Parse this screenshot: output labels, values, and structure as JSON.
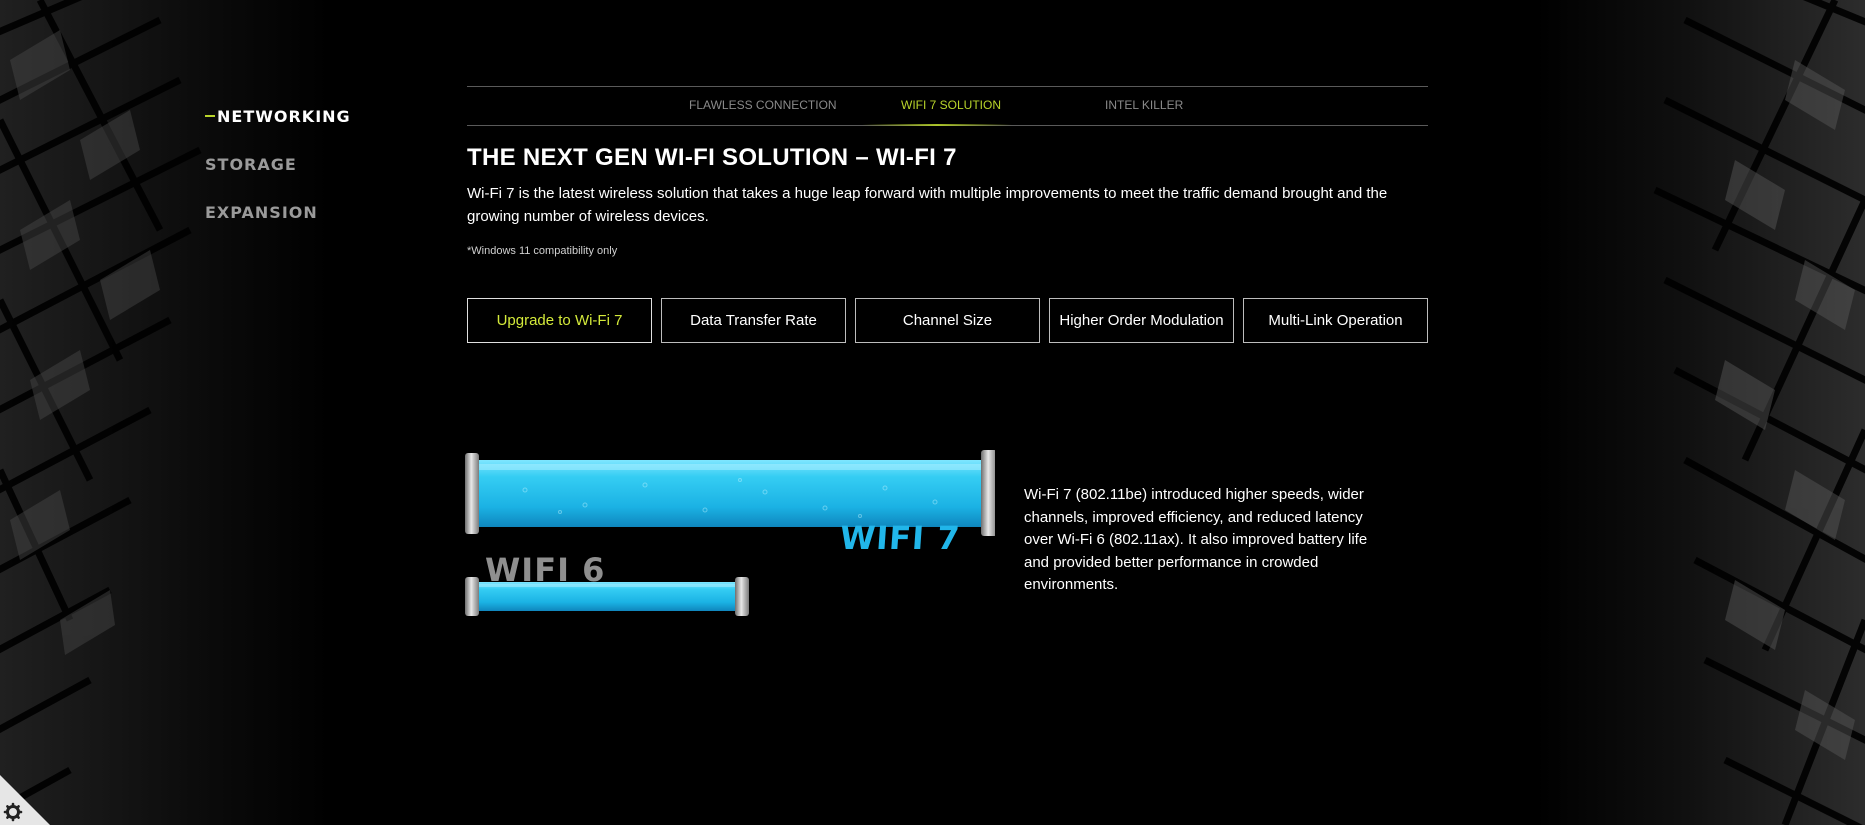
{
  "side_nav": {
    "items": [
      {
        "label": "NETWORKING",
        "active": true
      },
      {
        "label": "STORAGE",
        "active": false
      },
      {
        "label": "EXPANSION",
        "active": false
      }
    ]
  },
  "tabs": [
    {
      "label": "FLAWLESS CONNECTION",
      "active": false
    },
    {
      "label": "WIFI 7 SOLUTION",
      "active": true
    },
    {
      "label": "INTEL KILLER",
      "active": false
    }
  ],
  "section": {
    "title": "THE NEXT GEN WI-FI SOLUTION – WI-FI 7",
    "description": "Wi-Fi 7 is the latest wireless solution that takes a huge leap forward with multiple improvements to meet the traffic demand brought and the growing number of wireless devices.",
    "note": "*Windows 11 compatibility only"
  },
  "features": [
    {
      "label": "Upgrade to Wi-Fi 7",
      "active": true
    },
    {
      "label": "Data Transfer Rate",
      "active": false
    },
    {
      "label": "Channel Size",
      "active": false
    },
    {
      "label": "Higher Order Modulation",
      "active": false
    },
    {
      "label": "Multi-Link Operation",
      "active": false
    }
  ],
  "illustration": {
    "wifi7_label": "WIFI 7",
    "wifi6_label": "WIFI 6",
    "text": "Wi-Fi 7 (802.11be) introduced higher speeds, wider channels, improved efficiency, and reduced latency over Wi-Fi 6 (802.11ax). It also improved battery life and provided better performance in crowded environments."
  },
  "colors": {
    "accent": "#b9d42a",
    "active_feature_text": "#d4ea3a",
    "wifi7_blue": "#21b6ea",
    "wifi6_gray": "#8f8f8f",
    "background": "#000000"
  },
  "icons": {
    "cookie_settings": "gear-icon"
  }
}
